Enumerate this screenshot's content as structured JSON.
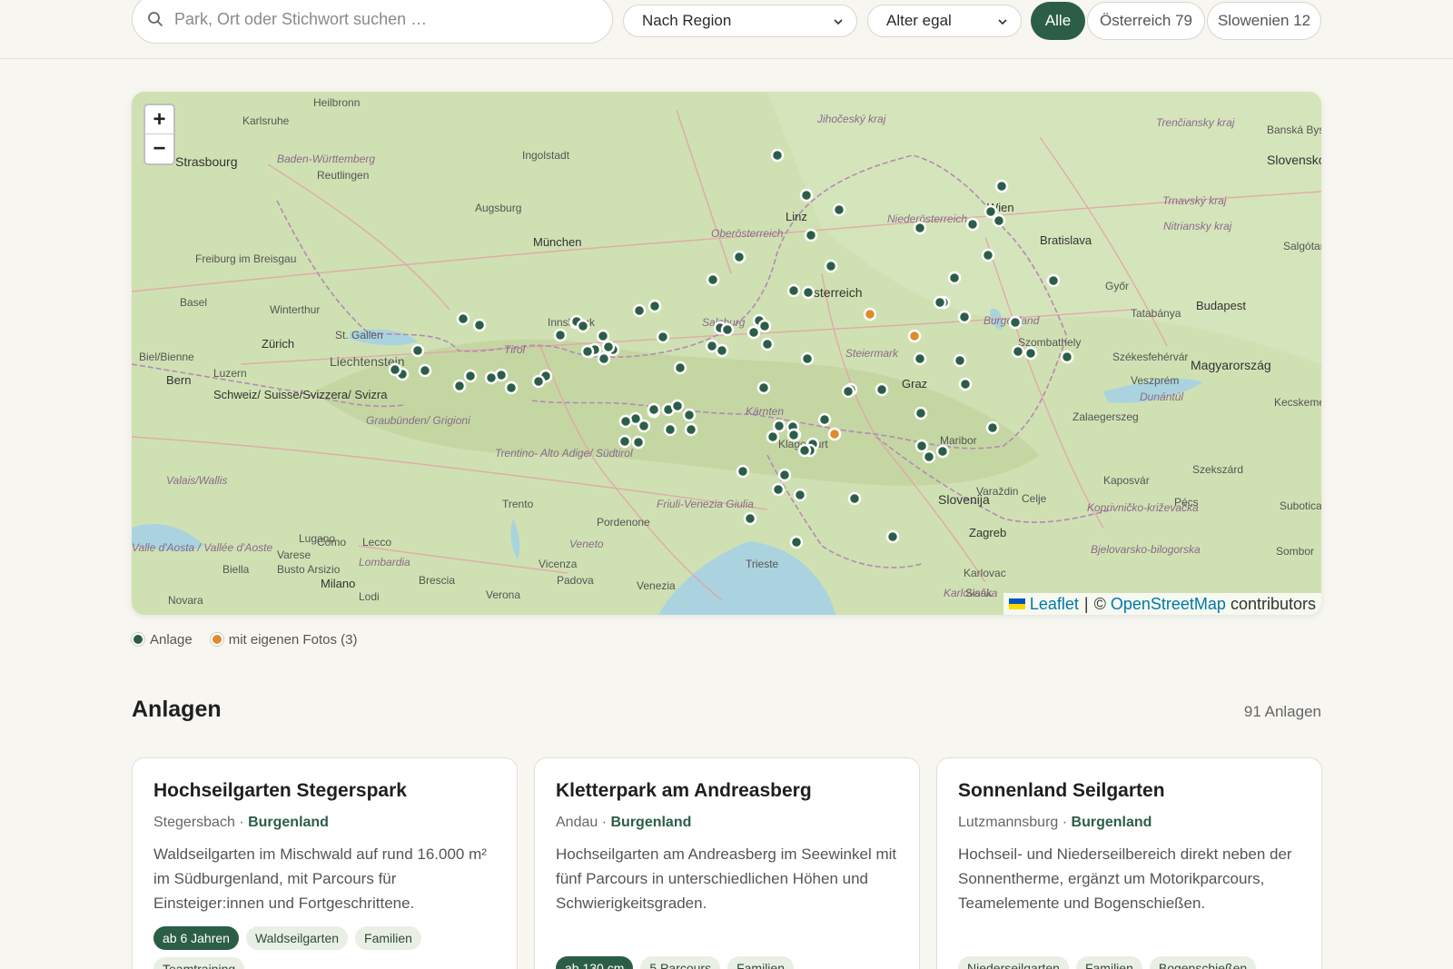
{
  "search": {
    "placeholder": "Park, Ort oder Stichwort suchen …"
  },
  "filters": {
    "region": "Nach Region",
    "age": "Alter egal",
    "countries": [
      {
        "label": "Alle",
        "active": true
      },
      {
        "label": "Österreich 79",
        "active": false
      },
      {
        "label": "Slowenien 12",
        "active": false
      }
    ]
  },
  "map": {
    "zoom_in": "+",
    "zoom_out": "−",
    "attribution": {
      "leaflet": "Leaflet",
      "separator": "|",
      "osm_prefix": "©",
      "osm": "OpenStreetMap",
      "suffix": "contributors"
    },
    "place_labels": [
      "Heilbronn",
      "Karlsruhe",
      "Strasbourg",
      "Baden-Württemberg",
      "Reutlingen",
      "Ingolstadt",
      "Augsburg",
      "München",
      "Jihočeský kraj",
      "Linz",
      "Oberösterreich",
      "Niederösterreich",
      "Wien",
      "Bratislava",
      "Trenčiansky kraj",
      "Banská Bystrica",
      "Slovensko",
      "Trnavský kraj",
      "Nitriansky kraj",
      "Salgótarján",
      "Freiburg im Breisgau",
      "Basel",
      "Winterthur",
      "St. Gallen",
      "Zürich",
      "Liechtenstein",
      "Tirol",
      "Innsbruck",
      "Salzburg",
      "Österreich",
      "Győr",
      "Budapest",
      "Tatabánya",
      "Burgenland",
      "Szombathely",
      "Magyarország",
      "Székesfehérvár",
      "Steiermark",
      "Graz",
      "Veszprém",
      "Kecskemét",
      "Biel/Bienne",
      "Bern",
      "Luzern",
      "Schweiz/ Suisse/Svizzera/ Svizra",
      "Graubünden/ Grigioni",
      "Trentino- Alto Adige/ Südtirol",
      "Kärnten",
      "Klagenfurt",
      "Maribor",
      "Zalaegerszeg",
      "Dunántúl",
      "Valais/Wallis",
      "Lugano",
      "Como",
      "Lecco",
      "Trento",
      "Friuli-Venezia Giulia",
      "Pordenone",
      "Slovenija",
      "Celje",
      "Varaždin",
      "Kaposvár",
      "Szekszárd",
      "Pécs",
      "Valle d'Aosta / Vallée d'Aoste",
      "Varese",
      "Busto Arsizio",
      "Biella",
      "Milano",
      "Lombardia",
      "Brescia",
      "Veneto",
      "Vicenza",
      "Padova",
      "Venezia",
      "Trieste",
      "Zagreb",
      "Karlovac",
      "Sisak",
      "Karlovačka",
      "Koprivničko-križevačka",
      "Bjelovarsko-bilogorska",
      "Novara",
      "Lodi",
      "Verona",
      "Sombor",
      "Subotica"
    ]
  },
  "legend": {
    "item1": "Anlage",
    "item2": "mit eigenen Fotos (3)"
  },
  "section": {
    "title": "Anlagen",
    "count": "91 Anlagen"
  },
  "cards": [
    {
      "title": "Hochseilgarten Stegerspark",
      "city": "Stegersbach",
      "sep": " · ",
      "region": "Burgenland",
      "desc": "Waldseilgarten im Mischwald auf rund 16.000 m² im Südburgenland, mit Parcours für Einsteiger:innen und Fortgeschrittene.",
      "tags": [
        "ab 6 Jahren",
        "Waldseilgarten",
        "Familien",
        "Teamtraining"
      ]
    },
    {
      "title": "Kletterpark am Andreasberg",
      "city": "Andau",
      "sep": " · ",
      "region": "Burgenland",
      "desc": "Hochseilgarten am Andreasberg im Seewinkel mit fünf Parcours in unterschiedlichen Höhen und Schwierigkeitsgraden.",
      "tags": [
        "ab 130 cm",
        "5 Parcours",
        "Familien"
      ]
    },
    {
      "title": "Sonnenland Seilgarten",
      "city": "Lutzmannsburg",
      "sep": " · ",
      "region": "Burgenland",
      "desc": "Hochseil- und Niederseilbereich direkt neben der Sonnentherme, ergänzt um Motorikparcours, Teamelemente und Bogenschießen.",
      "tags": [
        "Niederseilgarten",
        "Familien",
        "Bogenschießen"
      ]
    }
  ],
  "colors": {
    "accent": "#2c5e47",
    "photo_marker": "#e08a2c"
  }
}
